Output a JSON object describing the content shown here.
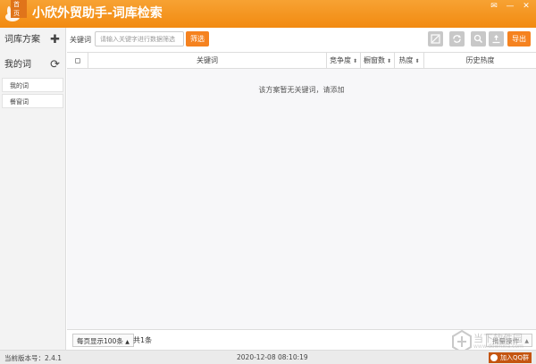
{
  "window": {
    "title": "小欣外贸助手-词库检索",
    "home_label": "首页",
    "controls": [
      "✉",
      "—",
      "✕"
    ]
  },
  "sidebar": {
    "schemes_label": "词库方案",
    "my_words_label": "我的词",
    "items": [
      {
        "label": "我的词"
      },
      {
        "label": "餐窗词"
      }
    ]
  },
  "toolbar": {
    "keyword_label": "关键词",
    "keyword_placeholder": "请输入关键字进行数据筛选",
    "keyword_value": "",
    "filter_label": "筛选",
    "export_label": "导出",
    "icons": [
      "clear-icon",
      "refresh-icon",
      "search-icon",
      "upload-icon"
    ]
  },
  "table": {
    "columns": [
      {
        "label": "",
        "type": "checkbox"
      },
      {
        "label": "关键词"
      },
      {
        "label": "竞争度",
        "sortable": true
      },
      {
        "label": "橱窗数",
        "sortable": true
      },
      {
        "label": "热度",
        "sortable": true
      },
      {
        "label": "历史热度"
      }
    ],
    "rows": [],
    "empty_message": "该方案暂无关键词，请添加"
  },
  "footer": {
    "page_size_label": "每页显示100条",
    "total_label": "共1条",
    "batch_label": "批量操作"
  },
  "status": {
    "version": "当前版本号：2.4.1",
    "datetime": "2020-12-08 08:10:19",
    "qq_label": "加入QQ群"
  },
  "watermark": {
    "text": "当下软件园",
    "sub": "www.downxia.com"
  },
  "colors": {
    "accent": "#f5821f",
    "titlebar": "#f39220"
  }
}
